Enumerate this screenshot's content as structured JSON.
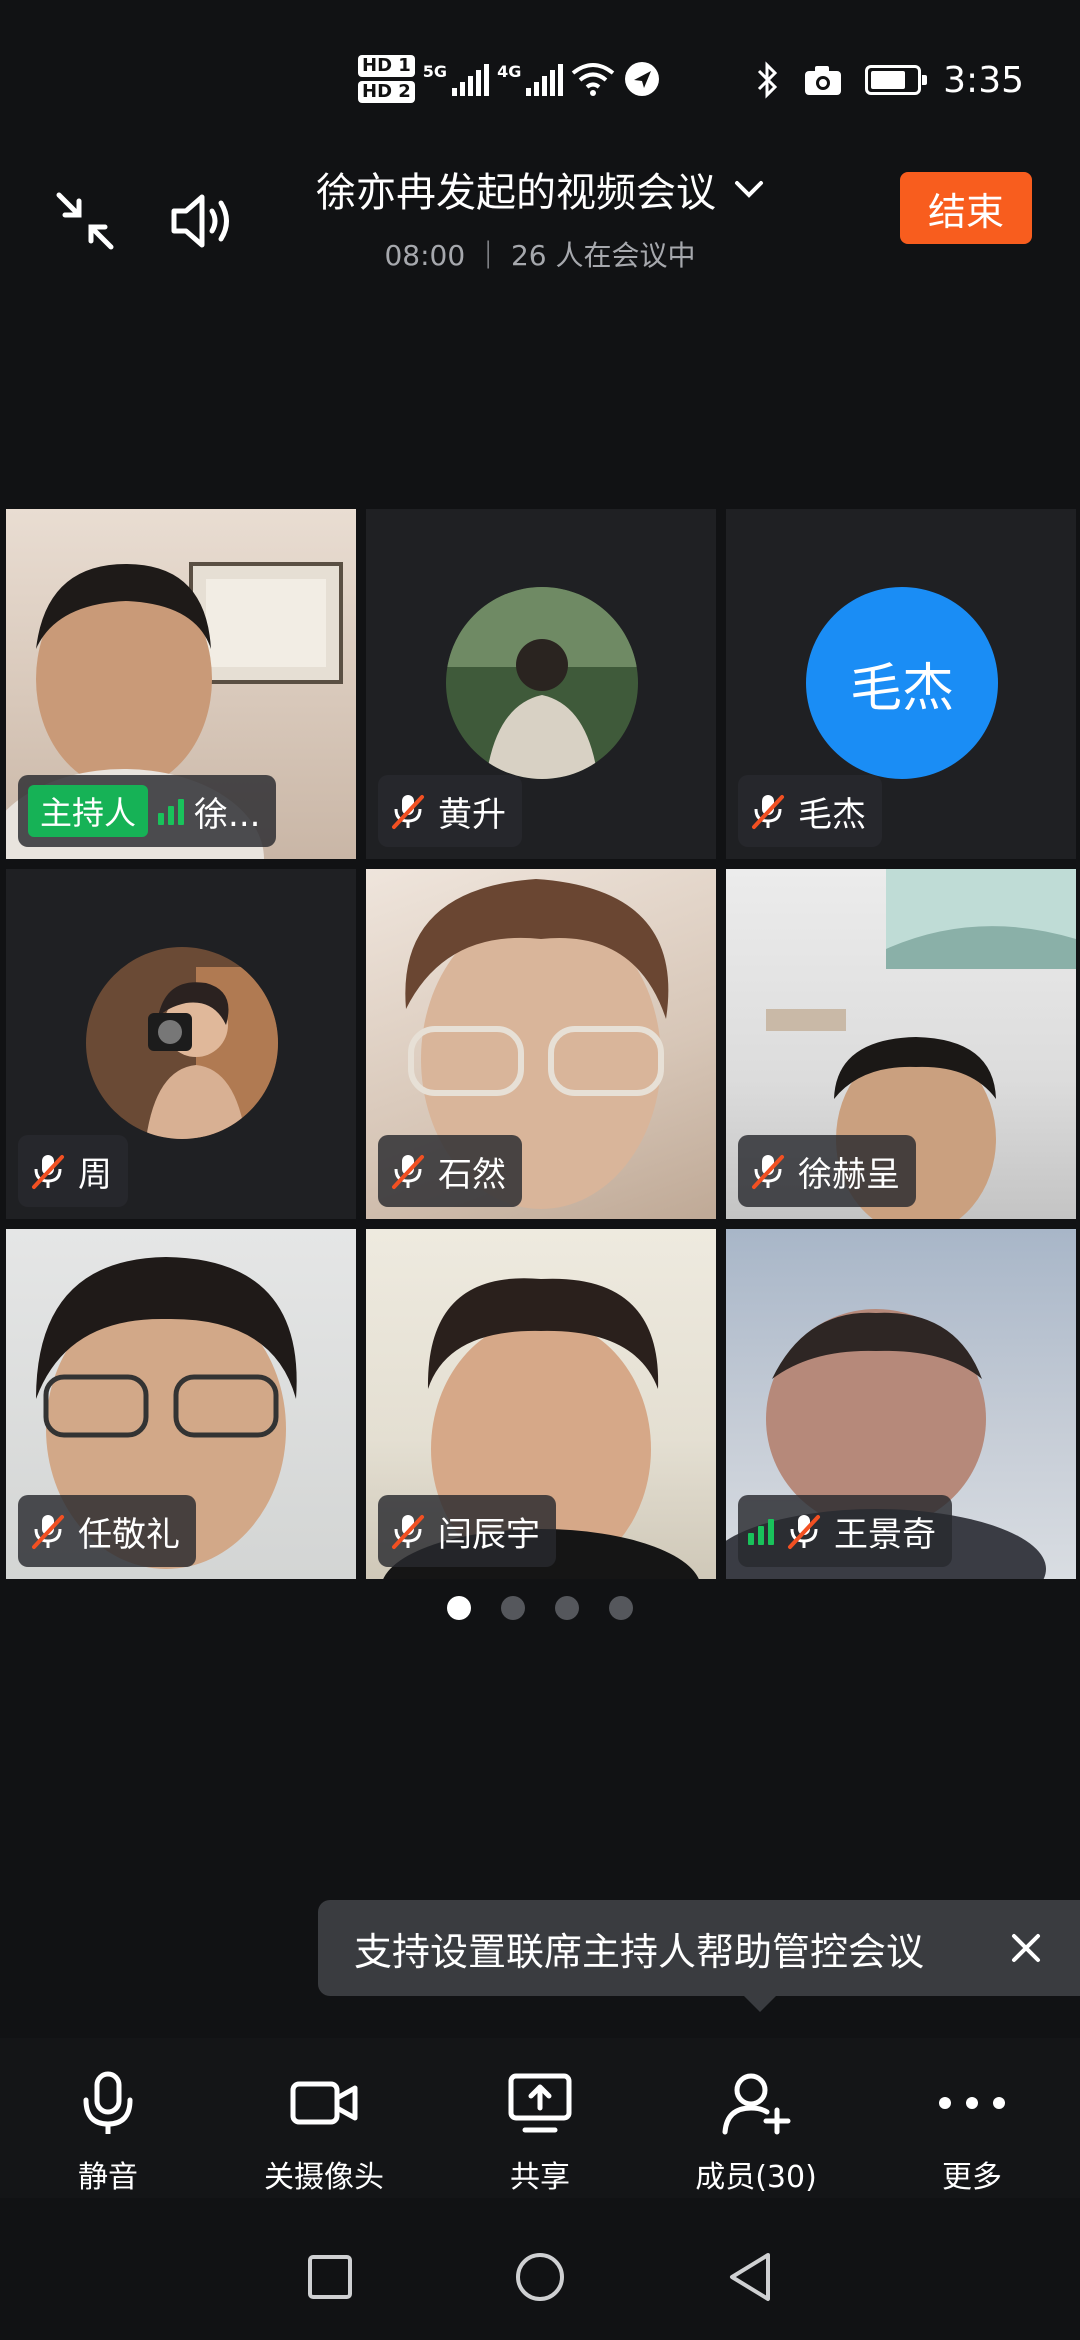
{
  "status_bar": {
    "hd1": "HD 1",
    "hd2": "HD 2",
    "network1": "5G",
    "network2": "4G",
    "time": "3:35"
  },
  "header": {
    "title": "徐亦冉发起的视频会议",
    "subtitle": "08:00 ｜ 26 人在会议中",
    "end_label": "结束"
  },
  "participants": [
    {
      "name": "徐...",
      "host_label": "主持人",
      "speaking": true,
      "muted": false,
      "kind": "video"
    },
    {
      "name": "黄升",
      "muted": true,
      "kind": "photo-avatar"
    },
    {
      "name": "毛杰",
      "avatar_text": "毛杰",
      "muted": true,
      "kind": "text-avatar"
    },
    {
      "name": "周",
      "muted": true,
      "kind": "photo-avatar"
    },
    {
      "name": "石然",
      "muted": true,
      "kind": "video"
    },
    {
      "name": "徐赫呈",
      "muted": true,
      "kind": "video"
    },
    {
      "name": "任敬礼",
      "muted": true,
      "kind": "video"
    },
    {
      "name": "闫辰宇",
      "muted": true,
      "kind": "video"
    },
    {
      "name": "王景奇",
      "muted": true,
      "speaking": true,
      "kind": "video"
    }
  ],
  "pager": {
    "pages": 4,
    "current": 1
  },
  "tooltip": {
    "text": "支持设置联席主持人帮助管控会议"
  },
  "toolbar": {
    "mute": "静音",
    "camera": "关摄像头",
    "share": "共享",
    "members": "成员(30)",
    "more": "更多"
  },
  "colors": {
    "end_button": "#f85d1e",
    "host_badge": "#16b256",
    "text_avatar": "#1a8df5",
    "speaking_bars": "#19c25b"
  }
}
